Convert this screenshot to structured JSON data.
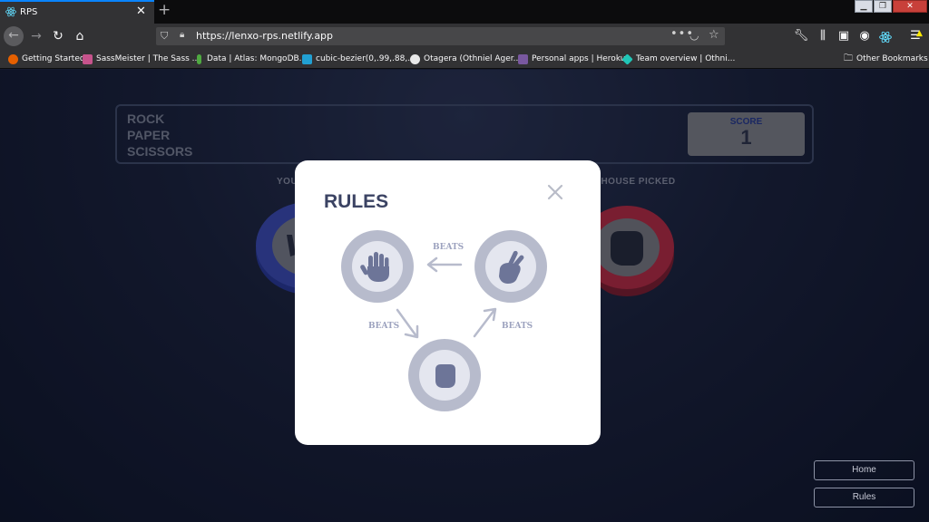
{
  "browser": {
    "tab_title": "RPS",
    "tab_close": "✕",
    "new_tab": "+",
    "url": "https://lenxo-rps.netlify.app",
    "url_more": "•••",
    "window_controls": [
      "▁",
      "❐",
      "✕"
    ],
    "bookmarks": [
      {
        "label": "Getting Started",
        "icon": "firefox-icon",
        "color": "#e66000"
      },
      {
        "label": "SassMeister | The Sass ...",
        "icon": "sassmeister-icon",
        "color": "#c6538c"
      },
      {
        "label": "Data | Atlas: MongoDB...",
        "icon": "mongodb-leaf-icon",
        "color": "#4faa41"
      },
      {
        "label": "cubic-bezier(0,.99,.88,....",
        "icon": "cubic-bezier-icon",
        "color": "#21a0d2"
      },
      {
        "label": "Otagera (Othniel Ager...",
        "icon": "github-icon",
        "color": "#e8e8e8"
      },
      {
        "label": "Personal apps | Heroku",
        "icon": "heroku-icon",
        "color": "#79589f"
      },
      {
        "label": "Team overview | Othni...",
        "icon": "netlify-icon",
        "color": "#20c6b7"
      }
    ],
    "other_bookmarks": "Other Bookmarks"
  },
  "game": {
    "logo_lines": [
      "ROCK",
      "PAPER",
      "SCISSORS"
    ],
    "score_label": "SCORE",
    "score_value": "1",
    "you_picked": "YOU",
    "house_picked": "E HOUSE PICKED"
  },
  "rules_modal": {
    "title": "RULES",
    "close_icon": "close-icon",
    "beats": [
      "BEATS",
      "BEATS",
      "BEATS"
    ],
    "nodes": [
      "paper",
      "scissors",
      "rock"
    ]
  },
  "nav_buttons": {
    "home": "Home",
    "rules": "Rules"
  },
  "colors": {
    "paper_ring": "#3b4bb1",
    "rock_ring": "#b72a3f",
    "modal_node": "#b7bbcc",
    "title": "#3b4363"
  }
}
